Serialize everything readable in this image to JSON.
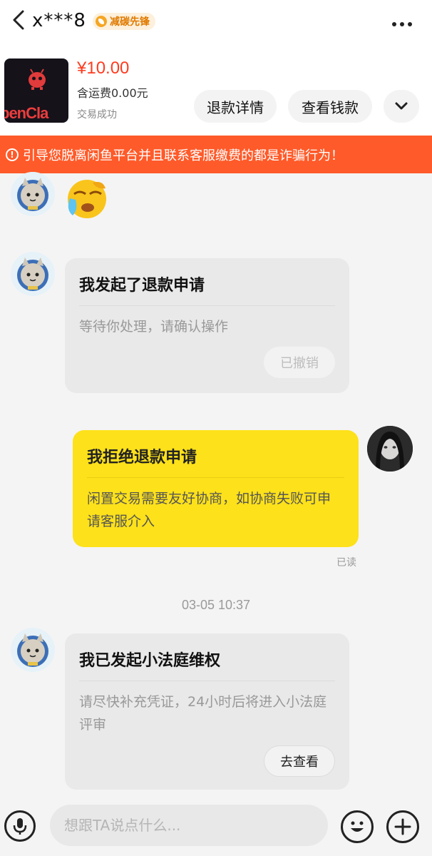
{
  "header": {
    "nickname": "x***8",
    "badge": "减碳先锋",
    "back_icon": "chevron-left-icon",
    "more_icon": "more-dots-icon"
  },
  "item": {
    "image_text": "penCla",
    "price": "¥10.00",
    "shipping": "含运费0.00元",
    "status": "交易成功",
    "refund_detail_button": "退款详情",
    "view_money_button": "查看钱款",
    "expand_icon": "chevron-down-icon"
  },
  "warning": {
    "text": "引导您脱离闲鱼平台并且联系客服缴费的都是诈骗行为！",
    "icon": "alert-circle-icon"
  },
  "messages": [
    {
      "title": "我发起了退款申请",
      "body": "等待你处理，请确认操作",
      "button": "已撤销"
    },
    {
      "title": "我拒绝退款申请",
      "body": "闲置交易需要友好协商，如协商失败可申请客服介入",
      "read_status": "已读"
    },
    {
      "title": "我已发起小法庭维权",
      "body": "请尽快补充凭证，24小时后将进入小法庭评审",
      "button": "去查看"
    }
  ],
  "timestamp": "03-05 10:37",
  "input": {
    "placeholder": "想跟TA说点什么..."
  },
  "colors": {
    "price": "#ff3b1f",
    "warning_bg": "#ff5a29",
    "own_bubble": "#fde11a",
    "badge_text": "#e07a00"
  }
}
